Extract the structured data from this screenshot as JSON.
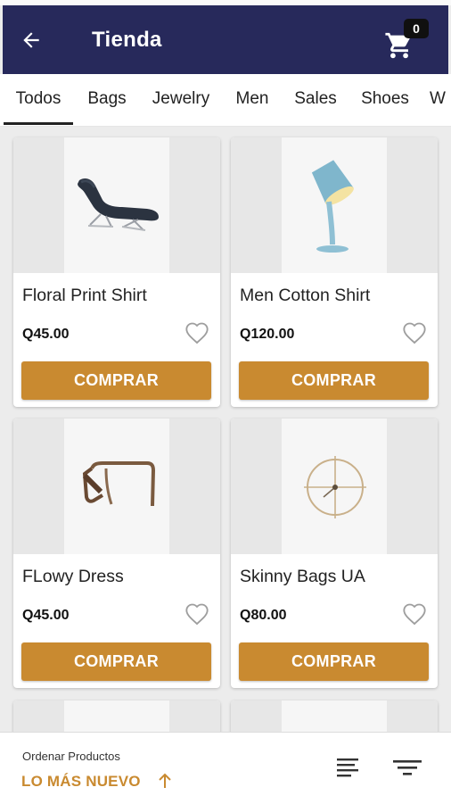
{
  "app_bar": {
    "title": "Tienda",
    "cart_count": "0",
    "icons": {
      "back": "arrow-back-icon",
      "cart": "shopping-cart-icon"
    }
  },
  "tabs": [
    {
      "label": "Todos",
      "active": true
    },
    {
      "label": "Bags",
      "active": false
    },
    {
      "label": "Jewelry",
      "active": false
    },
    {
      "label": "Men",
      "active": false
    },
    {
      "label": "Sales",
      "active": false
    },
    {
      "label": "Shoes",
      "active": false
    },
    {
      "label": "W",
      "active": false
    }
  ],
  "products": [
    {
      "name": "Floral Print Shirt",
      "price": "Q45.00",
      "buy_label": "COMPRAR",
      "image": "lounge-chair"
    },
    {
      "name": "Men Cotton Shirt",
      "price": "Q120.00",
      "buy_label": "COMPRAR",
      "image": "pouring-lamp"
    },
    {
      "name": "FLowy Dress",
      "price": "Q45.00",
      "buy_label": "COMPRAR",
      "image": "bent-wood-table"
    },
    {
      "name": "Skinny Bags UA",
      "price": "Q80.00",
      "buy_label": "COMPRAR",
      "image": "wall-clock"
    }
  ],
  "bottom_bar": {
    "sort_caption": "Ordenar Productos",
    "sort_value": "LO MÁS NUEVO",
    "icons": {
      "sort_direction": "arrow-up-icon",
      "list": "list-view-icon",
      "filter": "filter-icon"
    }
  },
  "colors": {
    "app_bar": "#27295b",
    "accent": "#c98a30",
    "background": "#ececec",
    "card": "#ffffff"
  }
}
